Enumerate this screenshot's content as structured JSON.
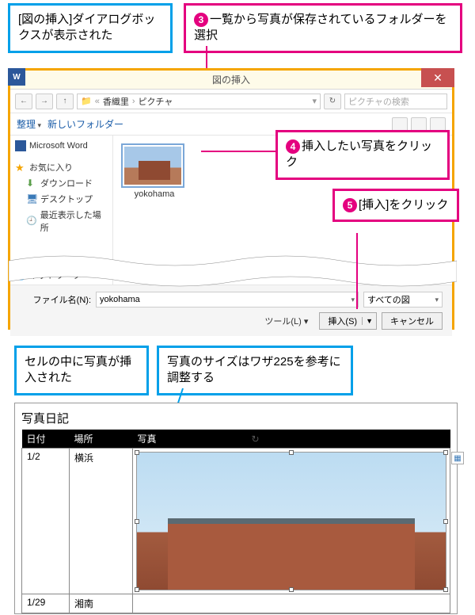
{
  "callouts": {
    "c1": "[図の挿入]ダイアログボックスが表示された",
    "c3": "一覧から写真が保存されているフォルダーを選択",
    "c4": "挿入したい写真をクリック",
    "c5": "[挿入]をクリック",
    "r1": "セルの中に写真が挿入された",
    "r2": "写真のサイズはワザ225を参考に調整する",
    "n3": "3",
    "n4": "4",
    "n5": "5"
  },
  "dialog": {
    "title": "図の挿入",
    "breadcrumb": {
      "p1": "香織里",
      "p2": "ピクチャ"
    },
    "search_placeholder": "ピクチャの検索",
    "organize": "整理",
    "new_folder": "新しいフォルダー",
    "sidebar": {
      "msword": "Microsoft Word",
      "fav": "お気に入り",
      "download": "ダウンロード",
      "desktop": "デスクトップ",
      "recent": "最近表示した場所",
      "network": "ネットワーク"
    },
    "thumb_name": "yokohama",
    "filename_label": "ファイル名(N):",
    "filename_value": "yokohama",
    "filter": "すべての図",
    "tool": "ツール(L)",
    "insert_btn": "挿入(S)",
    "cancel_btn": "キャンセル"
  },
  "result": {
    "doc_title": "写真日記",
    "headers": {
      "date": "日付",
      "place": "場所",
      "photo": "写真"
    },
    "rows": [
      {
        "date": "1/2",
        "place": "横浜"
      },
      {
        "date": "1/29",
        "place": "湘南"
      }
    ]
  }
}
